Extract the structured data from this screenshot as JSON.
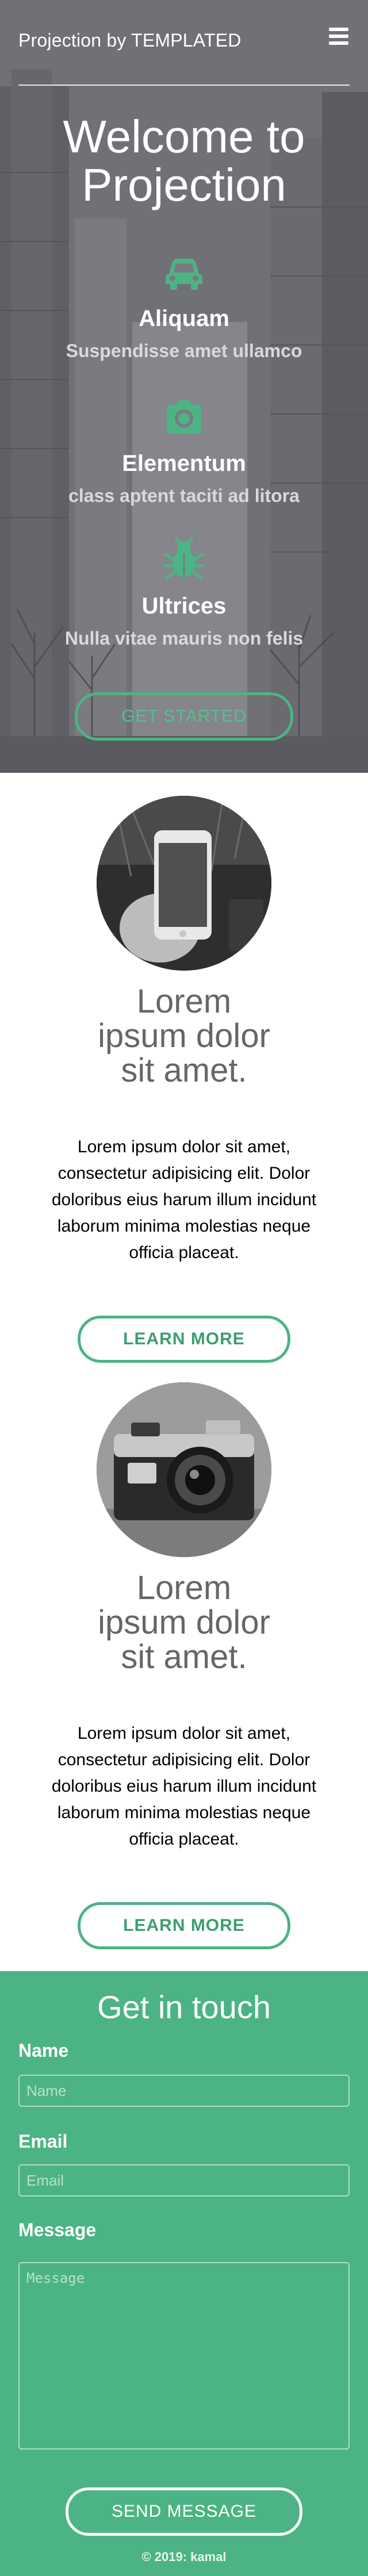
{
  "header": {
    "brand": "Projection by TEMPLATED",
    "menu_icon": "hamburger-menu-icon"
  },
  "hero": {
    "title": "Welcome to Projection",
    "features": [
      {
        "icon": "car-icon",
        "title": "Aliquam",
        "description": "Suspendisse amet ullamco"
      },
      {
        "icon": "camera-icon",
        "title": "Elementum",
        "description": "class aptent taciti ad litora"
      },
      {
        "icon": "bug-icon",
        "title": "Ultrices",
        "description": "Nulla vitae mauris non felis"
      }
    ],
    "cta_label": "GET STARTED"
  },
  "cards": [
    {
      "image": "phone-camera-photo",
      "title": "Lorem ipsum dolor sit amet.",
      "text": "Lorem ipsum dolor sit amet, consectetur adipisicing elit. Dolor doloribus eius harum illum incidunt laborum minima molestias neque officia placeat.",
      "button_label": "LEARN MORE"
    },
    {
      "image": "vintage-camera-photo",
      "title": "Lorem ipsum dolor sit amet.",
      "text": "Lorem ipsum dolor sit amet, consectetur adipisicing elit. Dolor doloribus eius harum illum incidunt laborum minima molestias neque officia placeat.",
      "button_label": "LEARN MORE"
    }
  ],
  "contact": {
    "title": "Get in touch",
    "name_label": "Name",
    "name_placeholder": "Name",
    "email_label": "Email",
    "email_placeholder": "Email",
    "message_label": "Message",
    "message_placeholder": "Message",
    "send_label": "SEND MESSAGE",
    "footer": "© 2019: kamal"
  },
  "colors": {
    "accent": "#4cb484",
    "hero_overlay": "#6f6f76",
    "text_dark": "#000000",
    "title_gray": "#666666"
  }
}
